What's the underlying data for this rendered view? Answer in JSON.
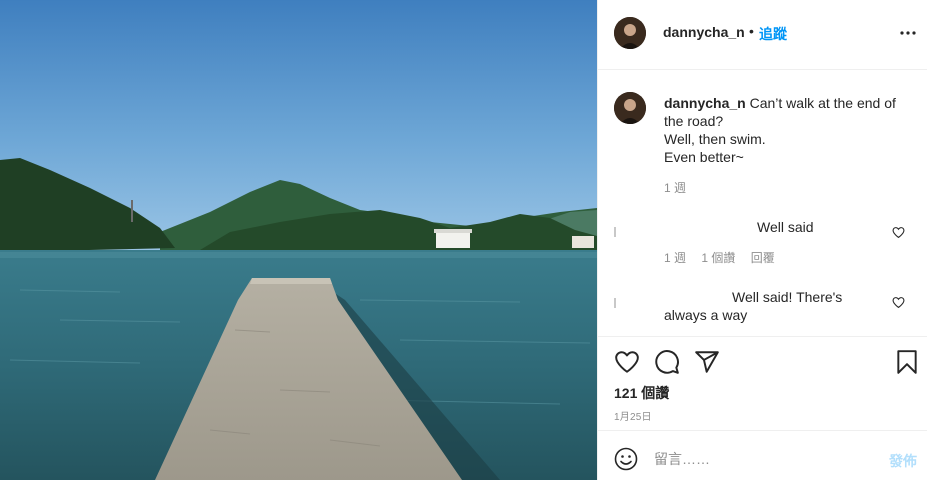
{
  "post": {
    "username": "dannycha_n",
    "separator": "•",
    "follow_label": "追蹤",
    "more_icon": "more-horizontal-icon"
  },
  "caption": {
    "username": "dannycha_n",
    "line1": "Can’t walk at the end of the road?",
    "line2": "Well, then swim.",
    "line3": "Even better~",
    "time": "1 週"
  },
  "comments": [
    {
      "text": "Well said",
      "time": "1 週",
      "likes": "1 個讚",
      "reply": "回覆",
      "heart_icon": "heart-outline-icon"
    },
    {
      "text": "Well said! There's always a way",
      "heart_icon": "heart-outline-icon"
    }
  ],
  "actions": {
    "icons": [
      "heart-icon",
      "comment-icon",
      "share-icon",
      "bookmark-icon"
    ],
    "likes": "121 個讚",
    "date": "1月25日"
  },
  "composer": {
    "emoji_icon": "emoji-icon",
    "placeholder": "留言……",
    "post_label": "發佈"
  },
  "colors": {
    "accent": "#0095f6",
    "post_disabled": "#b2dffc",
    "muted": "#8e8e8e",
    "text": "#262626"
  }
}
